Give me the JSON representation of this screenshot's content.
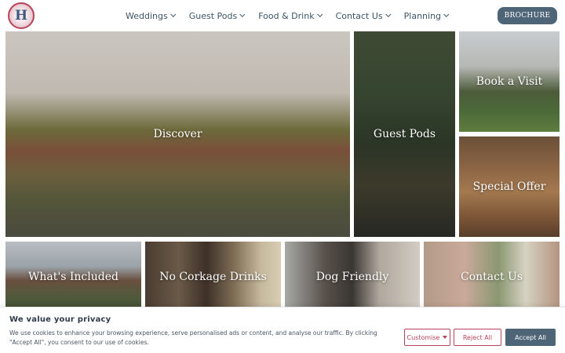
{
  "header": {
    "logo_letter": "H",
    "nav": [
      {
        "label": "Weddings"
      },
      {
        "label": "Guest Pods"
      },
      {
        "label": "Food & Drink"
      },
      {
        "label": "Contact Us"
      },
      {
        "label": "Planning"
      }
    ],
    "brochure_label": "BROCHURE"
  },
  "tiles": {
    "discover": "Discover",
    "guest_pods": "Guest Pods",
    "book_a_visit": "Book a Visit",
    "special_offer": "Special Offer",
    "whats_included": "What's Included",
    "no_corkage": "No Corkage Drinks",
    "dog_friendly": "Dog Friendly",
    "contact_us": "Contact Us"
  },
  "cookie": {
    "title": "We value your privacy",
    "text": "We use cookies to enhance your browsing experience, serve personalised ads or content, and analyse our traffic. By clicking \"Accept All\", you consent to our use of cookies.",
    "customise_label": "Customise",
    "reject_label": "Reject All",
    "accept_label": "Accept All"
  },
  "colors": {
    "accent": "#4e6577",
    "brand_red": "#b7435a",
    "nav_text": "#3e5568"
  }
}
